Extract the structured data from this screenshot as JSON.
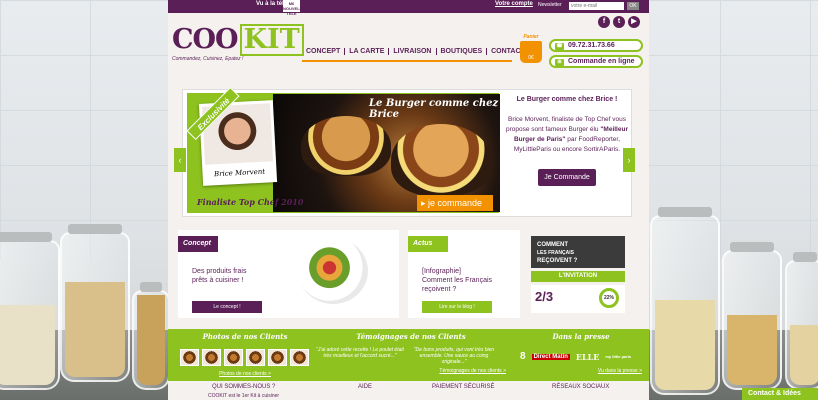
{
  "topbar": {
    "tv_text": "Vu à la télé !",
    "tv_logo": "M6 NOUVELLE TELE",
    "account": "Votre compte",
    "newsletter": "Newsletter",
    "email_placeholder": "votre e-mail",
    "ok": "OK"
  },
  "social": [
    "f",
    "t",
    "▶"
  ],
  "logo": {
    "cook": "COO",
    "kit": "KIT",
    "tagline": "Commandez, Cuisinez, Epatez !"
  },
  "nav": [
    "CONCEPT",
    "LA CARTE",
    "LIVRAISON",
    "BOUTIQUES",
    "CONTACT"
  ],
  "panier": {
    "label": "Panier",
    "count": "0€"
  },
  "phone": "09.72.31.73.66",
  "order_online": "Commande en ligne",
  "slider": {
    "ribbon": "Exclusivité",
    "title": "Le Burger comme chez Brice",
    "chef_name": "Brice Morvent",
    "finalist": "Finaliste Top Chef 2010",
    "cta": "je commande",
    "desc_title": "Le Burger comme chez Brice !",
    "desc_1": "Brice Morvent, finaliste de Top Chef vous propose sont fameux Burger élu ",
    "desc_bold": "\"Meilleur Burger de Paris\"",
    "desc_2": " par FoodReporter, MyLittleParis ou encore SortirAParis.",
    "button": "Je Commande"
  },
  "blocks": {
    "concept": {
      "tag": "Concept",
      "text_1": "Des produits frais",
      "text_2": "prêts à cuisiner !",
      "button": "Le concept !"
    },
    "actus": {
      "tag": "Actus",
      "text_1": "[Infographie]",
      "text_2": "Comment les Français",
      "text_3": "reçoivent ?",
      "button": "Lire sur le blog !"
    },
    "invitation": {
      "top_1": "COMMENT",
      "top_2": "LES FRANÇAIS",
      "top_3": "REÇOIVENT ?",
      "label": "L'INVITATION",
      "big": "2/3",
      "pct": "22%"
    }
  },
  "band": {
    "photos_title": "Photos de nos Clients",
    "photos_link": "Photos de nos clients >",
    "testi_title": "Témoignages de nos Clients",
    "quote_1": "\"J'ai adoré cette recette ! Le poulet était très moelleux et l'accord sucré...\"",
    "quote_2": "\"De bons produits, qui vont très bien ensemble. Une sauce au coing originale...\"",
    "testi_link": "Témoignages de nos clients >",
    "press_title": "Dans la presse",
    "press_items": [
      "8",
      "Direct Matin",
      "ELLE",
      "my little paris"
    ],
    "press_link": "Vu dans la presse >"
  },
  "footer": {
    "who": "QUI SOMMES-NOUS ?",
    "who_sub": "COOKIT est le 1er Kit à cuisiner",
    "help": "AIDE",
    "payment": "PAIEMENT SÉCURISÉ",
    "social": "RÉSEAUX SOCIAUX"
  },
  "contact_tab": "Contact & Idées"
}
